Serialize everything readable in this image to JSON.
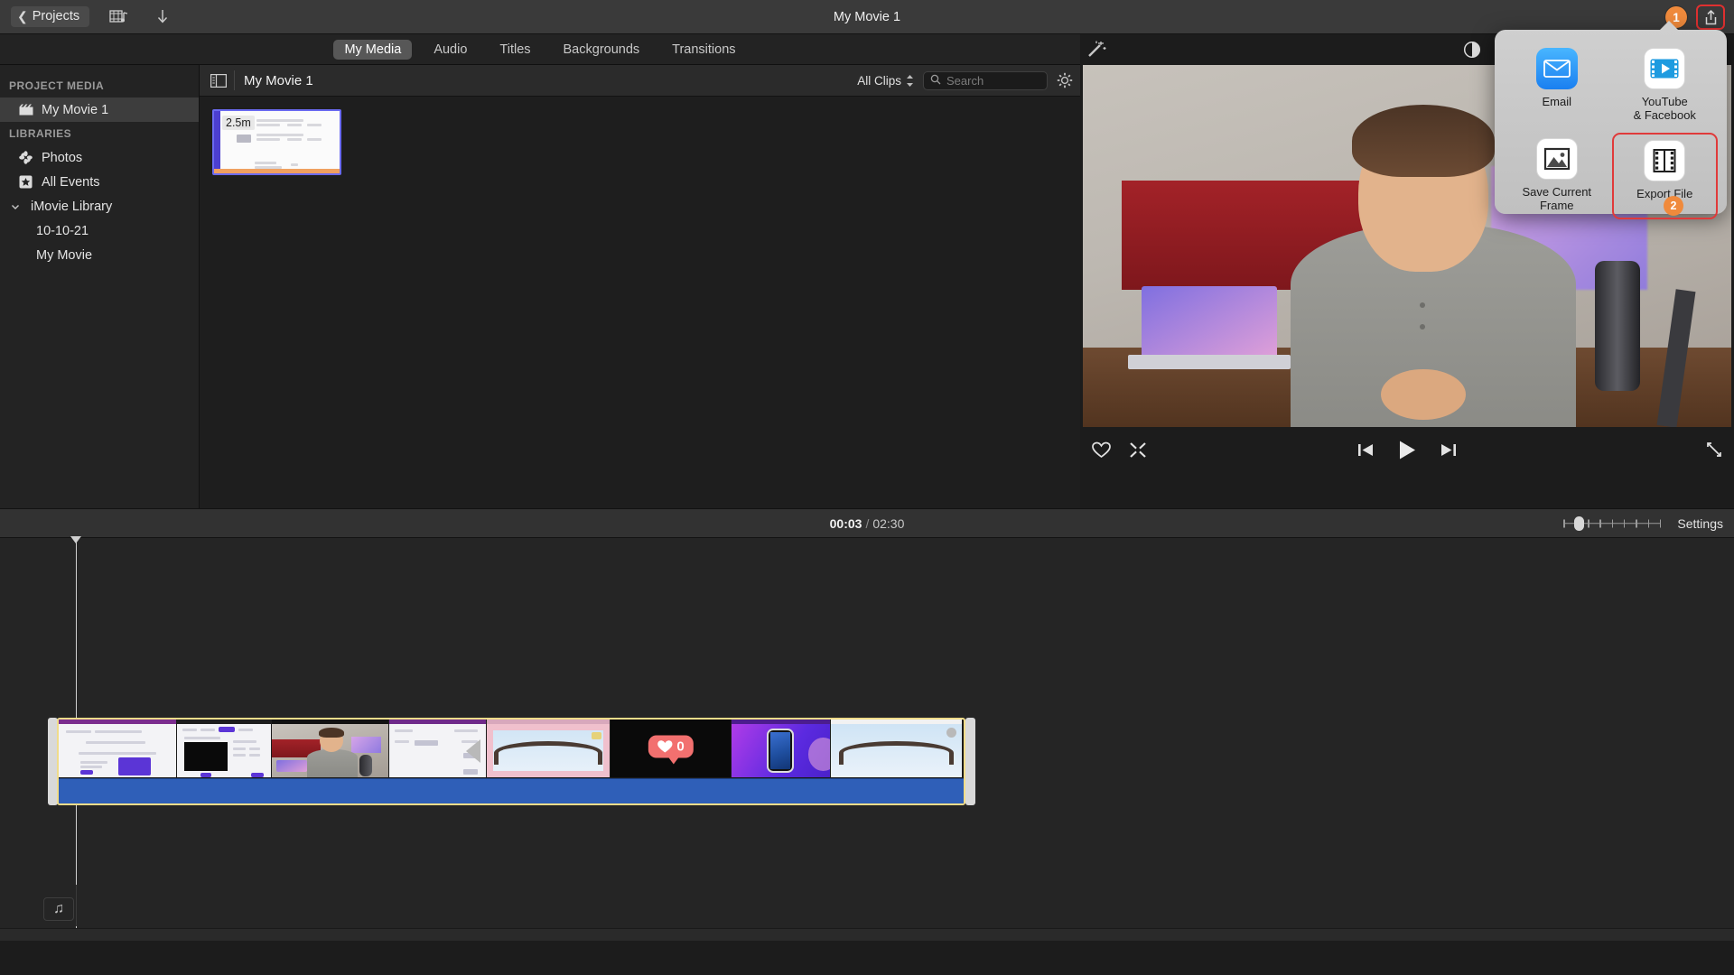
{
  "window": {
    "title": "My Movie 1"
  },
  "toolbar": {
    "back_label": "Projects",
    "media_icon": "film-music-icon",
    "import_icon": "download-arrow-icon",
    "share_icon": "share-icon",
    "share_badge": "1"
  },
  "tabs": [
    {
      "label": "My Media",
      "active": true
    },
    {
      "label": "Audio",
      "active": false
    },
    {
      "label": "Titles",
      "active": false
    },
    {
      "label": "Backgrounds",
      "active": false
    },
    {
      "label": "Transitions",
      "active": false
    }
  ],
  "sidebar": {
    "sections": [
      {
        "header": "PROJECT MEDIA",
        "items": [
          {
            "label": "My Movie 1",
            "icon": "clapperboard-icon",
            "selected": true
          }
        ]
      },
      {
        "header": "LIBRARIES",
        "items": [
          {
            "label": "Photos",
            "icon": "photos-flower-icon",
            "selected": false
          },
          {
            "label": "All Events",
            "icon": "star-box-icon",
            "selected": false
          },
          {
            "label": "iMovie Library",
            "icon": "chevron-down-icon",
            "selected": false
          },
          {
            "label": "10-10-21",
            "icon": "",
            "selected": false
          },
          {
            "label": "My Movie",
            "icon": "",
            "selected": false
          }
        ]
      }
    ]
  },
  "browser": {
    "sidebar_toggle_icon": "sidebar-toggle-icon",
    "title": "My Movie 1",
    "filter_label": "All Clips",
    "search_placeholder": "Search",
    "search_value": "",
    "settings_icon": "gear-icon",
    "clips": [
      {
        "duration": "2.5m",
        "selected": true
      }
    ]
  },
  "viewer": {
    "enhance_icon": "magic-wand-icon",
    "tools": [
      {
        "icon": "color-balance-icon",
        "name": "color-balance"
      },
      {
        "icon": "color-correction-icon",
        "name": "color-correction"
      },
      {
        "icon": "crop-icon",
        "name": "crop"
      },
      {
        "icon": "stabilization-icon",
        "name": "stabilization"
      },
      {
        "icon": "volume-icon",
        "name": "volume"
      },
      {
        "icon": "noise-reduction-icon",
        "name": "noise-reduction"
      },
      {
        "icon": "speed-icon",
        "name": "speed"
      },
      {
        "icon": "filters-icon",
        "name": "clip-filter"
      },
      {
        "icon": "info-icon",
        "name": "information"
      }
    ],
    "favorite_icon": "heart-icon",
    "reject_icon": "reject-x-icon",
    "prev_icon": "skip-back-icon",
    "play_icon": "play-icon",
    "next_icon": "skip-forward-icon",
    "fullscreen_icon": "fullscreen-icon"
  },
  "timeline": {
    "current_time": "00:03",
    "separator": "/",
    "total_time": "02:30",
    "zoom_slider_icon": "zoom-slider",
    "settings_label": "Settings",
    "music_icon": "music-note-icon",
    "clips": [
      {
        "name": "slides-clip",
        "kind": "browser"
      },
      {
        "name": "dialog-clip",
        "kind": "dialog"
      },
      {
        "name": "talking-head-clip",
        "kind": "person"
      },
      {
        "name": "form-clip",
        "kind": "form"
      },
      {
        "name": "coaster-clip-1",
        "kind": "coaster"
      },
      {
        "name": "like-counter-clip",
        "kind": "heart",
        "counter": "0"
      },
      {
        "name": "phone-promo-clip",
        "kind": "phone"
      },
      {
        "name": "coaster-clip-2",
        "kind": "coaster"
      }
    ]
  },
  "share_popup": {
    "items": [
      {
        "label": "Email",
        "icon": "email-icon",
        "selected": false
      },
      {
        "label": "YouTube\n& Facebook",
        "line1": "YouTube",
        "line2": "& Facebook",
        "icon": "youtube-facebook-icon",
        "selected": false
      },
      {
        "label": "Save Current Frame",
        "icon": "image-icon",
        "selected": false
      },
      {
        "label": "Export File",
        "icon": "film-strip-icon",
        "selected": true
      }
    ],
    "badge": "2"
  },
  "colors": {
    "accent_red": "#e03a3a",
    "badge_orange": "#f08a3c",
    "selection_yellow": "#f0dc8a",
    "audio_blue": "#2f5fb8",
    "media_select_blue": "#6a6af0"
  }
}
